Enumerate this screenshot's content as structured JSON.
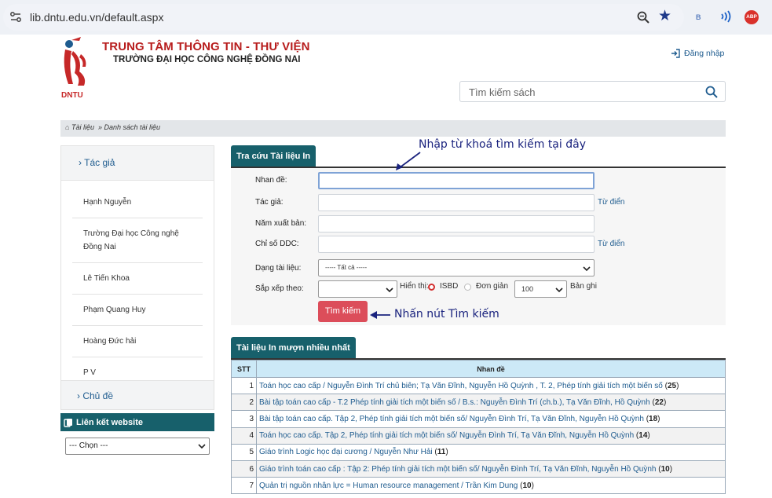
{
  "browser": {
    "url": "lib.dntu.edu.vn/default.aspx",
    "ext_b": "B",
    "ext_abp": "ABP"
  },
  "header": {
    "logo_text": "DNTU",
    "title": "TRUNG TÂM THÔNG TIN - THƯ VIỆN",
    "subtitle": "TRƯỜNG ĐẠI HỌC CÔNG NGHỆ ĐỒNG NAI",
    "login_label": "Đăng nhập",
    "search_placeholder": "Tìm kiếm sách"
  },
  "breadcrumb": {
    "home": "Tài liệu",
    "sep": "»",
    "current": "Danh sách tài liệu"
  },
  "sidebar": {
    "author_head": "› Tác giả",
    "authors": [
      "Hạnh Nguyễn",
      "Trường Đại học Công nghệ Đồng Nai",
      "Lê Tiến Khoa",
      "Phạm Quang Huy",
      "Hoàng Đức hải",
      "P V"
    ],
    "subject_head": "› Chủ đề",
    "links_head": "Liên kết website",
    "links_select": "--- Chọn ---"
  },
  "form": {
    "tab": "Tra cứu Tài liệu In",
    "title_label": "Nhan đề:",
    "author_label": "Tác giả:",
    "year_label": "Năm xuất bản:",
    "ddc_label": "Chỉ số DDC:",
    "type_label": "Dạng tài liệu:",
    "type_value": "----- Tất cả -----",
    "sort_label": "Sắp xếp theo:",
    "display_label": "Hiển thị:",
    "isbd_label": "ISBD",
    "simple_label": "Đơn giản",
    "per_page": "100",
    "per_page_unit": "Bản ghi",
    "dict_link": "Từ điển",
    "search_button": "Tìm kiếm"
  },
  "annotations": {
    "keyword_hint": "Nhập từ khoá tìm kiếm tại đây",
    "button_hint": "Nhấn nút Tìm kiếm"
  },
  "table": {
    "tab": "Tài liệu In mượn nhiều nhất",
    "col_stt": "STT",
    "col_title": "Nhan đề",
    "rows": [
      {
        "stt": "1",
        "title": "Toán học cao cấp / Nguyễn Đình Trí chủ biên; Tạ Văn Đĩnh, Nguyễn Hồ Quỳnh , T. 2, Phép tính giải tích một biến số",
        "count": "25"
      },
      {
        "stt": "2",
        "title": "Bài tập toán cao cấp - T.2 Phép tính giải tích một biến số / B.s.: Nguyễn Đình Trí (ch.b.), Tạ Văn Đĩnh, Hồ Quỳnh",
        "count": "22"
      },
      {
        "stt": "3",
        "title": "Bài tập toán cao cấp. Tập 2, Phép tính giải tích một biến số/ Nguyễn Đình Trí, Tạ Văn Đĩnh, Nguyễn Hồ Quỳnh",
        "count": "18"
      },
      {
        "stt": "4",
        "title": "Toán học cao cấp. Tập 2, Phép tính giải tích một biến số/ Nguyễn Đình Trí, Tạ Văn Đĩnh, Nguyễn Hồ Quỳnh",
        "count": "14"
      },
      {
        "stt": "5",
        "title": "Giáo trình Logic học đại cương / Nguyễn Như Hải",
        "count": "11"
      },
      {
        "stt": "6",
        "title": "Giáo trình toán cao cấp : Tập 2: Phép tính giải tích một biến số/ Nguyễn Đình Trí, Tạ Văn Đĩnh, Nguyễn Hồ Quỳnh",
        "count": "10"
      },
      {
        "stt": "7",
        "title": "Quản trị nguồn nhân lực = Human resource management / Trần Kim Dung",
        "count": "10"
      }
    ]
  },
  "colors": {
    "teal": "#17606b",
    "brand_red": "#b71c1c",
    "button_red": "#dc4d5a",
    "header_blue": "#cce9f7",
    "annotation_blue": "#1a237e"
  }
}
